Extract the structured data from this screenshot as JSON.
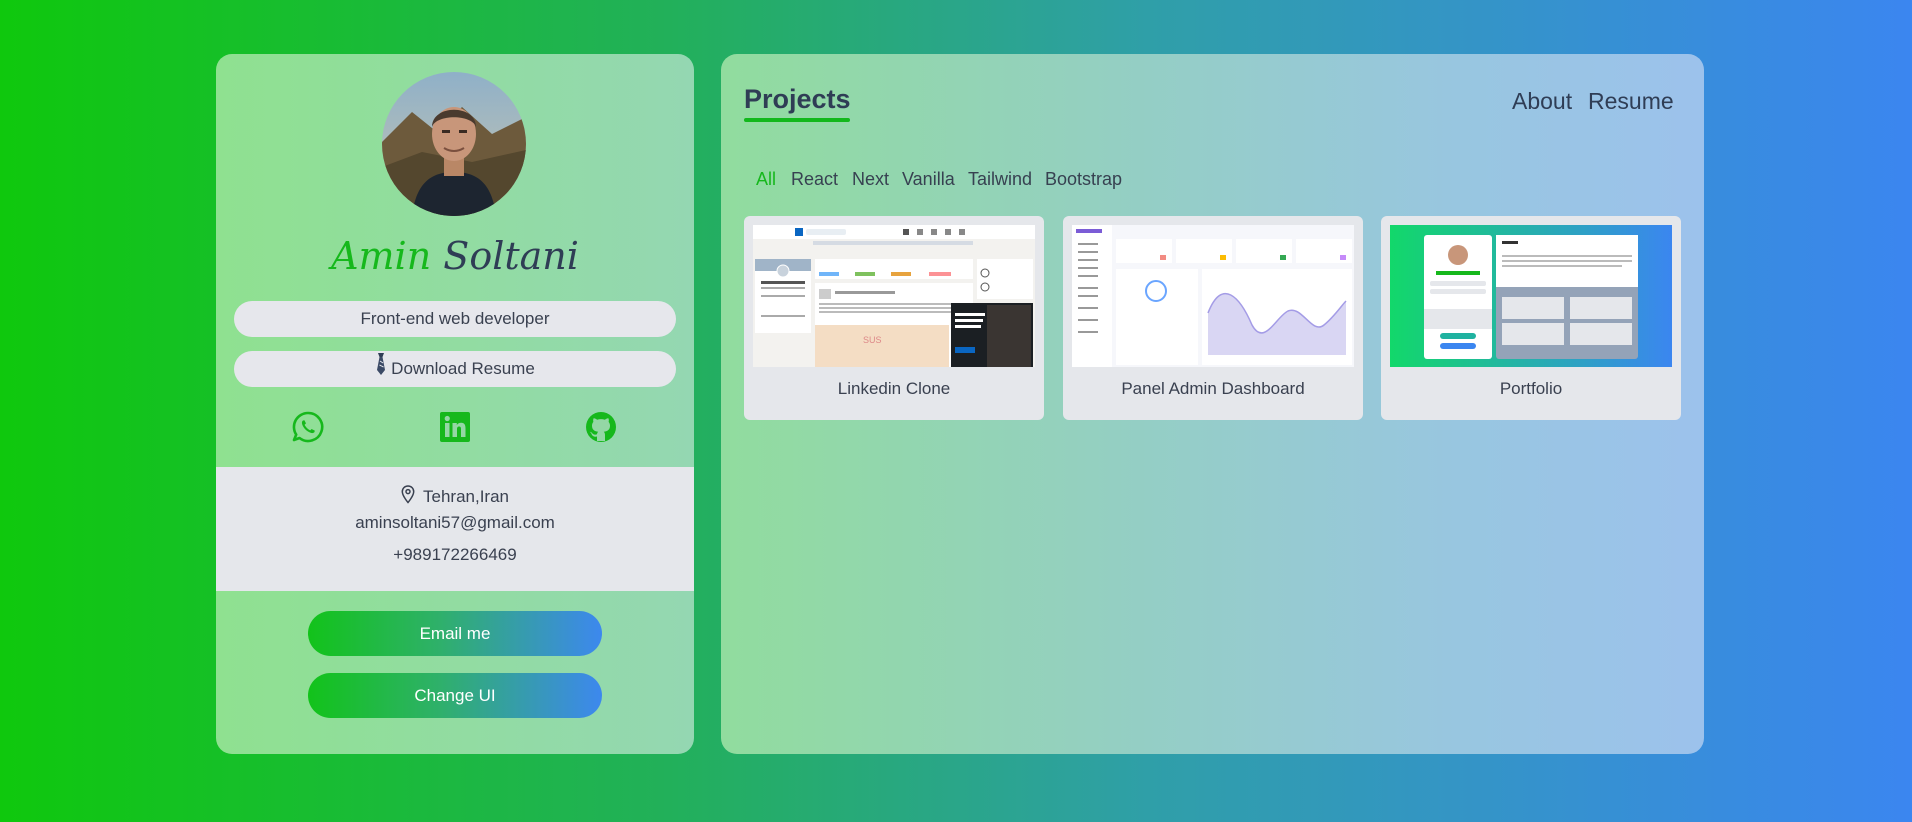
{
  "profile": {
    "first_name": "Amin",
    "last_name": "Soltani",
    "role": "Front-end web developer",
    "download_label": "Download Resume",
    "socials": [
      {
        "icon": "whatsapp-icon"
      },
      {
        "icon": "linkedin-icon"
      },
      {
        "icon": "github-icon"
      }
    ],
    "location": "Tehran,Iran",
    "email": "aminsoltani57@gmail.com",
    "phone": "+989172266469",
    "email_button": "Email me",
    "change_ui_button": "Change UI"
  },
  "projects": {
    "title": "Projects",
    "nav": [
      "About",
      "Resume"
    ],
    "filters": [
      "All",
      "React",
      "Next",
      "Vanilla",
      "Tailwind",
      "Bootstrap"
    ],
    "active_filter": "All",
    "cards": [
      {
        "title": "Linkedin Clone"
      },
      {
        "title": "Panel Admin Dashboard"
      },
      {
        "title": "Portfolio"
      }
    ]
  },
  "colors": {
    "accent_green": "#16b81c",
    "accent_blue": "#3b86f0",
    "text_dark": "#2f3d55"
  }
}
